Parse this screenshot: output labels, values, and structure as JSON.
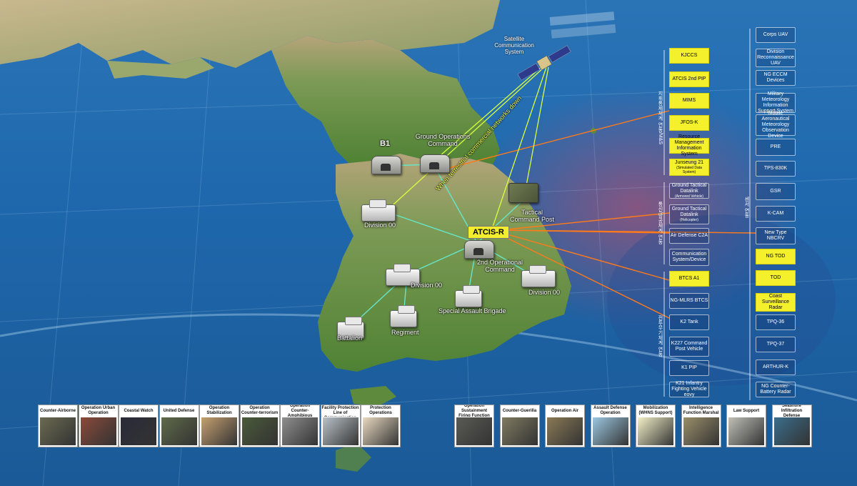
{
  "map": {
    "satellite_label": "Satellite Communication System",
    "b1_label": "B1",
    "goc_label": "Ground Operations Command",
    "tcp_label": "Tactical Command Post",
    "atcis_label": "ATCIS-R",
    "soc_label": "2nd Operational Command",
    "div_nw_label": "Division 00",
    "div_c_label": "Division 00",
    "div_e_label": "Division 00",
    "sab_label": "Special Assault Brigade",
    "battalion_label": "Battalion",
    "regiment_label": "Regiment",
    "link_text": "When terrestrial commercial networks down"
  },
  "groups": {
    "group1": "지휘통제체계 연동/M&S",
    "group2": "통신/방공체계 연동",
    "group3": "전투무기체계 연동",
    "sensors": "센서 연동"
  },
  "systems": [
    {
      "label": "KJCCS",
      "sub": "",
      "style": "yellow"
    },
    {
      "label": "ATCIS 2nd PIP",
      "sub": "",
      "style": "yellow"
    },
    {
      "label": "MIMS",
      "sub": "",
      "style": "yellow"
    },
    {
      "label": "JFOS-K",
      "sub": "",
      "style": "yellow"
    },
    {
      "label": "Resource Management Information System",
      "sub": "",
      "style": "yellow"
    },
    {
      "label": "Junseung 21",
      "sub": "(Simulated Data System)",
      "style": "yellow"
    },
    {
      "label": "Ground Tactical Datalink",
      "sub": "(Armored Vehicle)",
      "style": "plain"
    },
    {
      "label": "Ground Tactical Datalink",
      "sub": "(Helicopter)",
      "style": "plain"
    },
    {
      "label": "Air Defense C2A",
      "sub": "",
      "style": "plain"
    },
    {
      "label": "Communication System/Device",
      "sub": "",
      "style": "plain"
    },
    {
      "label": "BTCS A1",
      "sub": "",
      "style": "yellow"
    },
    {
      "label": "NG-MLRS BTCS",
      "sub": "",
      "style": "plain"
    },
    {
      "label": "K2 Tank",
      "sub": "",
      "style": "plain"
    },
    {
      "label": "K227 Command Post Vehicle",
      "sub": "",
      "style": "plain"
    },
    {
      "label": "K1 PIP",
      "sub": "",
      "style": "plain"
    },
    {
      "label": "K21 Infantry Fighting Vehicle eovy",
      "sub": "",
      "style": "plain"
    }
  ],
  "sensors": [
    {
      "label": "Corps UAV",
      "style": "plain"
    },
    {
      "label": "Division Reconnaissance UAV",
      "style": "plain"
    },
    {
      "label": "NG ECCM Devices",
      "style": "plain"
    },
    {
      "label": "Military Meteorology Information Support System",
      "style": "plain"
    },
    {
      "label": "Mobile Aeronautical Meteorology Observation Device",
      "style": "plain"
    },
    {
      "label": "PRE",
      "style": "plain"
    },
    {
      "label": "TPS-830K",
      "style": "plain"
    },
    {
      "label": "GSR",
      "style": "plain"
    },
    {
      "label": "K-CAM",
      "style": "plain"
    },
    {
      "label": "New Type NBCRV",
      "style": "plain"
    },
    {
      "label": "NG TOD",
      "style": "yellow"
    },
    {
      "label": "TOD",
      "style": "yellow"
    },
    {
      "label": "Coast Surveillance Radar",
      "style": "yellow"
    },
    {
      "label": "TPQ-36",
      "style": "plain"
    },
    {
      "label": "TPQ-37",
      "style": "plain"
    },
    {
      "label": "ARTHUR-K",
      "style": "plain"
    },
    {
      "label": "NG Counter-Battery Radar",
      "style": "plain"
    }
  ],
  "operations_left": [
    {
      "label": "Counter-Airborne",
      "photo": "soldiers-photo"
    },
    {
      "label": "Operation Urban Operation",
      "photo": "urban-photo"
    },
    {
      "label": "Coastal Watch",
      "photo": "coast-photo"
    },
    {
      "label": "United Defense",
      "photo": "defense-photo"
    },
    {
      "label": "Operation Stabilization",
      "photo": "desert-photo"
    },
    {
      "label": "Operation Counter-terrorism",
      "photo": "forest-photo"
    },
    {
      "label": "Operation Counter-Amphibious",
      "photo": "beach-photo"
    },
    {
      "label": "Operation Critical Facility Protection Line of Communication",
      "photo": "guard-photo"
    },
    {
      "label": "Protection Operations",
      "photo": "map-photo"
    }
  ],
  "operations_right": [
    {
      "label": "Operation Sustainment Firing Function",
      "photo": "artillery-photo"
    },
    {
      "label": "Counter-Guerilla",
      "photo": "howitzer-photo"
    },
    {
      "label": "Operation Air",
      "photo": "ground-photo"
    },
    {
      "label": "Assault Defense Operation",
      "photo": "parachute-photo"
    },
    {
      "label": "Mobilization (WHNS Support)",
      "photo": "emblem-photo"
    },
    {
      "label": "Intelligence Function Marshal",
      "photo": "terrain-photo"
    },
    {
      "label": "Law Support",
      "photo": "vehicle-photo"
    },
    {
      "label": "Seashore Infiltration Defense",
      "photo": "ship-photo"
    }
  ],
  "colors": {
    "accent_yellow": "#f5f02c",
    "link_cyan": "#66e6c8",
    "link_orange": "#ff7a1a",
    "link_satellite": "#d8ff40",
    "sea": "#1f68ad",
    "land": "#5b8a3c"
  }
}
